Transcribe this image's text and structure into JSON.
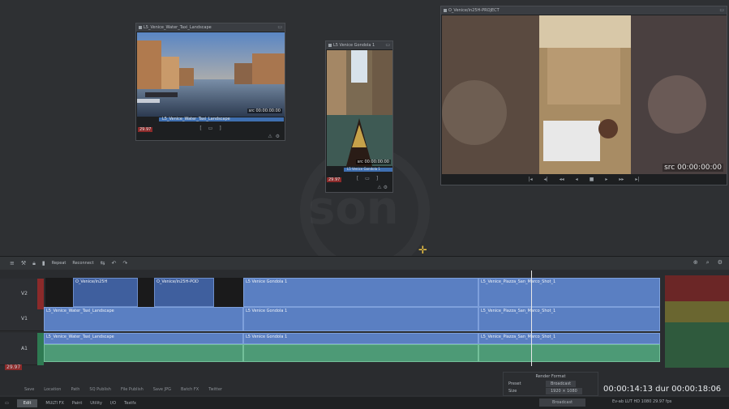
{
  "viewers": {
    "water_taxi": {
      "title": "L5_Venice_Water_Taxi_Landscape",
      "timecode": "src 00:00:00:00",
      "scrub_label": "L5_Venice_Water_Taxi_Landscape",
      "end_tc": "0:00",
      "frame": "29.97"
    },
    "gondola": {
      "title": "L5 Venice Gondola 1",
      "timecode": "src 00:00:00:00",
      "scrub_label": "L5 Venice Gondola 1",
      "frame": "29.97"
    },
    "project": {
      "title": "O_Venice/in25H-PROJECT",
      "timecode": "src 00:00:00:00"
    }
  },
  "timeline": {
    "toolbar": {
      "repeat_label": "Repeat",
      "reconnect_label": "Reconnect"
    },
    "tracks": [
      "V2",
      "V1",
      "A1"
    ],
    "clips": {
      "v2_a": "O_Venice/in25H",
      "v2_b": "O_Venice/in25H-POD",
      "v2_c": "L5 Venice Gondola 1",
      "v2_d": "L5_Venice_Piazza_San_Marco_Shot_1",
      "v1_a": "L5_Venice_Water_Taxi_Landscape",
      "v1_b": "L5 Venice Gondola 1",
      "v1_c": "L5_Venice_Piazza_San_Marco_Shot_1",
      "a1_a": "L5_Venice_Water_Taxi_Landscape",
      "a1_b": "L5 Venice Gondola 1",
      "a1_c": "L5_Venice_Piazza_San_Marco_Shot_1"
    },
    "frame_rate": "29.97"
  },
  "bottom_tabs": [
    "Save",
    "Location",
    "Path",
    "SQ Publish",
    "File Publish",
    "Save JPG",
    "Batch FX",
    "Twitter"
  ],
  "status": {
    "tabs": [
      "Edit",
      "MULTI FX",
      "Paint",
      "Utility",
      "I/O",
      "Textfx"
    ],
    "active": "Edit",
    "render_label": "Broadcast",
    "right_info": "Ev-ab   LUT   HD 1080 29.97 fps"
  },
  "render_panel": {
    "title": "Render Format",
    "preset_label": "Preset",
    "preset_value": "Broadcast",
    "size_label": "Size",
    "size_value": "1920 × 1080"
  },
  "timecode": "00:00:14:13 dur 00:00:18:06",
  "colors": {
    "video_clip": "#5a7fc2",
    "audio_clip": "#4d9a76",
    "accent": "#f2c744"
  }
}
